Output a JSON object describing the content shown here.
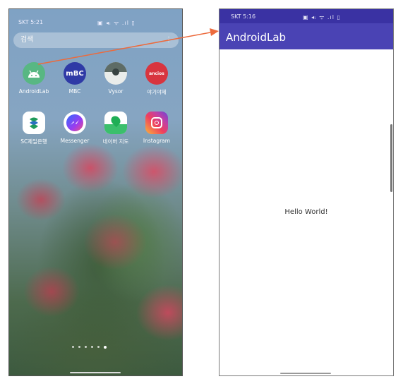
{
  "left_screen": {
    "status_time": "SKT 5:21",
    "status_icons": "▣ ◂ᵢ ᯤ .ıl ▯",
    "search_placeholder": "검색",
    "search_menu": "⋮",
    "apps": [
      {
        "label": "AndroidLab",
        "icon": "android-icon"
      },
      {
        "label": "MBC",
        "icon": "mbc-icon"
      },
      {
        "label": "Vysor",
        "icon": "vysor-icon"
      },
      {
        "label": "야기야제",
        "icon": "red-app-icon"
      },
      {
        "label": "SC제일은행",
        "icon": "sc-bank-icon"
      },
      {
        "label": "Messenger",
        "icon": "messenger-icon"
      },
      {
        "label": "네이버 지도",
        "icon": "naver-map-icon"
      },
      {
        "label": "Instagram",
        "icon": "instagram-icon"
      }
    ],
    "mbc_text": "mBC",
    "red_app_text": "ancios",
    "page_indicator": {
      "count": 6,
      "active": 6
    }
  },
  "right_screen": {
    "status_time": "SKT 5:16",
    "status_icons": "▣ ◂ᵢ ᯤ .ıl ▯",
    "app_title": "AndroidLab",
    "hello_text": "Hello World!"
  },
  "colors": {
    "status_bar": "#3a32a3",
    "app_bar": "#4a43b4",
    "arrow": "#ec6a3c"
  }
}
